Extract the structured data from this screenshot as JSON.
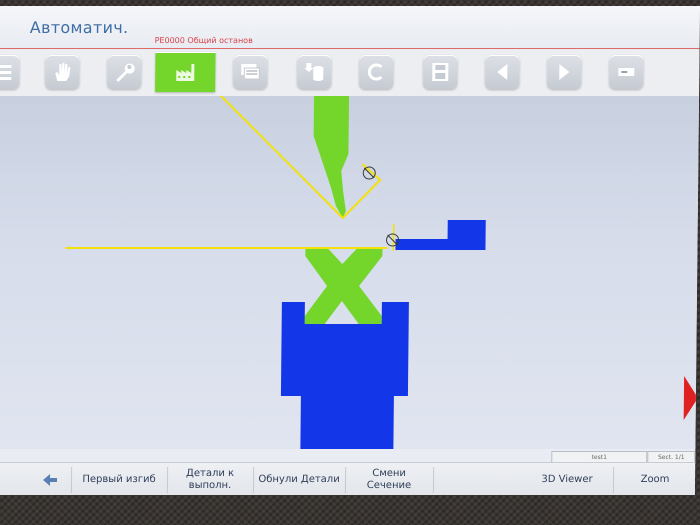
{
  "header": {
    "title": "Автоматич.",
    "alarm": "PE0000 Общий останов"
  },
  "toolbar": {
    "buttons": [
      {
        "icon": "list-icon"
      },
      {
        "icon": "hand-icon"
      },
      {
        "icon": "wrench-icon"
      },
      {
        "icon": "factory-icon",
        "active": true
      },
      {
        "icon": "layers-icon"
      },
      {
        "icon": "database-icon"
      },
      {
        "icon": "c-icon"
      },
      {
        "icon": "save-icon"
      },
      {
        "icon": "arrow-left-icon"
      },
      {
        "icon": "arrow-right-icon"
      },
      {
        "icon": "minus-icon"
      }
    ]
  },
  "status": {
    "program": "test1",
    "section": "Sect. 1/1"
  },
  "bottom": {
    "back": "back-arrow-icon",
    "first_bend": "Первый изгиб",
    "details_line1": "Детали к",
    "details_line2": "выполн.",
    "reset_details": "Обнули Детали",
    "change_section": "Смени Сечение",
    "viewer_3d": "3D Viewer",
    "zoom": "Zoom"
  },
  "colors": {
    "punch": "#74d62a",
    "die": "#1236e8",
    "sheet": "#f2e10a",
    "accent": "#3f6ea6",
    "alarm": "#d8454a"
  }
}
